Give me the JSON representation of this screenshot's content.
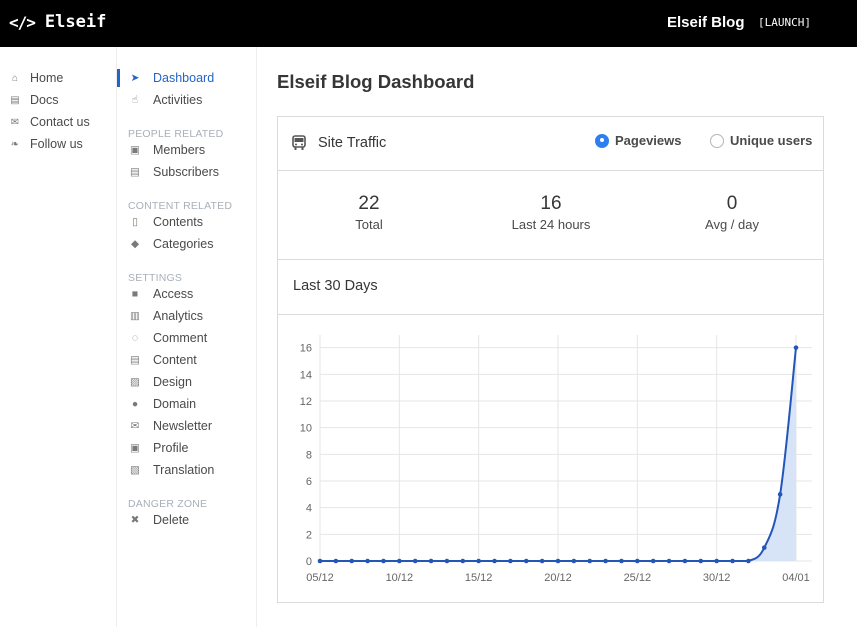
{
  "topbar": {
    "brand_icon": "</>",
    "brand": "Elseif",
    "blog_title": "Elseif Blog",
    "launch": "[LAUNCH]"
  },
  "mainnav": [
    {
      "icon": "home-icon",
      "glyph": "⌂",
      "label": "Home"
    },
    {
      "icon": "book-icon",
      "glyph": "▤",
      "label": "Docs"
    },
    {
      "icon": "envelope-icon",
      "glyph": "✉",
      "label": "Contact us"
    },
    {
      "icon": "twitter-icon",
      "glyph": "❧",
      "label": "Follow us"
    }
  ],
  "sidebar": {
    "top": [
      {
        "icon": "paper-plane-icon",
        "glyph": "➤",
        "label": "Dashboard",
        "active": true
      },
      {
        "icon": "hand-pointer-icon",
        "glyph": "☝",
        "label": "Activities"
      }
    ],
    "groups": [
      {
        "label": "PEOPLE RELATED",
        "items": [
          {
            "icon": "id-badge-icon",
            "glyph": "▣",
            "label": "Members"
          },
          {
            "icon": "id-card-icon",
            "glyph": "▤",
            "label": "Subscribers"
          }
        ]
      },
      {
        "label": "CONTENT RELATED",
        "items": [
          {
            "icon": "file-icon",
            "glyph": "▯",
            "label": "Contents"
          },
          {
            "icon": "tags-icon",
            "glyph": "◆",
            "label": "Categories"
          }
        ]
      },
      {
        "label": "SETTINGS",
        "items": [
          {
            "icon": "lock-icon",
            "glyph": "■",
            "label": "Access"
          },
          {
            "icon": "bar-chart-icon",
            "glyph": "▥",
            "label": "Analytics"
          },
          {
            "icon": "comment-icon",
            "glyph": "◌",
            "label": "Comment"
          },
          {
            "icon": "file-text-icon",
            "glyph": "▤",
            "label": "Content"
          },
          {
            "icon": "image-icon",
            "glyph": "▨",
            "label": "Design"
          },
          {
            "icon": "globe-icon",
            "glyph": "●",
            "label": "Domain"
          },
          {
            "icon": "envelope-open-icon",
            "glyph": "✉",
            "label": "Newsletter"
          },
          {
            "icon": "user-card-icon",
            "glyph": "▣",
            "label": "Profile"
          },
          {
            "icon": "language-icon",
            "glyph": "▧",
            "label": "Translation"
          }
        ]
      },
      {
        "label": "DANGER ZONE",
        "items": [
          {
            "icon": "close-icon",
            "glyph": "✖",
            "label": "Delete"
          }
        ]
      }
    ]
  },
  "main": {
    "page_title": "Elseif Blog Dashboard",
    "card_title": "Site Traffic",
    "radio_pageviews": "Pageviews",
    "radio_unique": "Unique users",
    "stats": [
      {
        "value": "22",
        "label": "Total"
      },
      {
        "value": "16",
        "label": "Last 24 hours"
      },
      {
        "value": "0",
        "label": "Avg / day"
      }
    ],
    "section_title": "Last 30 Days"
  },
  "colors": {
    "accent": "#2264c8",
    "radio": "#2f7ef0",
    "line": "#2256b8",
    "area": "#d7e3f7"
  },
  "chart_data": {
    "type": "area",
    "x": [
      "05/12",
      "06/12",
      "07/12",
      "08/12",
      "09/12",
      "10/12",
      "11/12",
      "12/12",
      "13/12",
      "14/12",
      "15/12",
      "16/12",
      "17/12",
      "18/12",
      "19/12",
      "20/12",
      "21/12",
      "22/12",
      "23/12",
      "24/12",
      "25/12",
      "26/12",
      "27/12",
      "28/12",
      "29/12",
      "30/12",
      "31/12",
      "01/01",
      "02/01",
      "03/01",
      "04/01"
    ],
    "values": [
      0,
      0,
      0,
      0,
      0,
      0,
      0,
      0,
      0,
      0,
      0,
      0,
      0,
      0,
      0,
      0,
      0,
      0,
      0,
      0,
      0,
      0,
      0,
      0,
      0,
      0,
      0,
      0,
      1,
      5,
      16
    ],
    "x_tick_labels": [
      "05/12",
      "10/12",
      "15/12",
      "20/12",
      "25/12",
      "30/12",
      "04/01"
    ],
    "y_ticks": [
      0,
      2,
      4,
      6,
      8,
      10,
      12,
      14,
      16
    ],
    "ylim": [
      0,
      16.5
    ],
    "grid": true,
    "title": "",
    "xlabel": "",
    "ylabel": ""
  }
}
